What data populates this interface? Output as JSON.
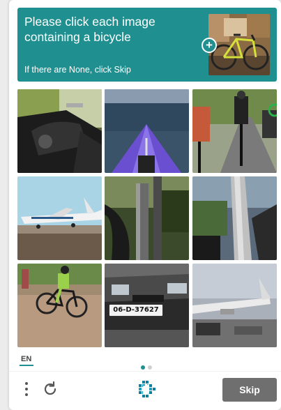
{
  "challenge": {
    "prompt_line1": "Please click each image",
    "prompt_line2": "containing a bicycle",
    "subtext": "If there are None, click Skip",
    "example_image_icon": "bicycle-example-photo",
    "add_icon": "plus-icon"
  },
  "grid": {
    "tiles": [
      {
        "icon": "motorcycle-photo"
      },
      {
        "icon": "kayak-photo"
      },
      {
        "icon": "cyclists-road-photo"
      },
      {
        "icon": "jet-plane-photo"
      },
      {
        "icon": "bicycle-fork-photo"
      },
      {
        "icon": "bicycle-rider-pov-photo"
      },
      {
        "icon": "mountain-biker-photo"
      },
      {
        "icon": "car-photo"
      },
      {
        "icon": "airliner-photo"
      }
    ],
    "license_plate": "06-D-37627"
  },
  "footer": {
    "language": "EN",
    "pagination": {
      "current": 1,
      "total": 2
    },
    "skip_label": "Skip",
    "menu_icon": "kebab-menu-icon",
    "refresh_icon": "refresh-icon",
    "logo_icon": "hcaptcha-logo-icon"
  },
  "colors": {
    "accent": "#1f8f8f",
    "skip_button": "#6f6f6f"
  }
}
